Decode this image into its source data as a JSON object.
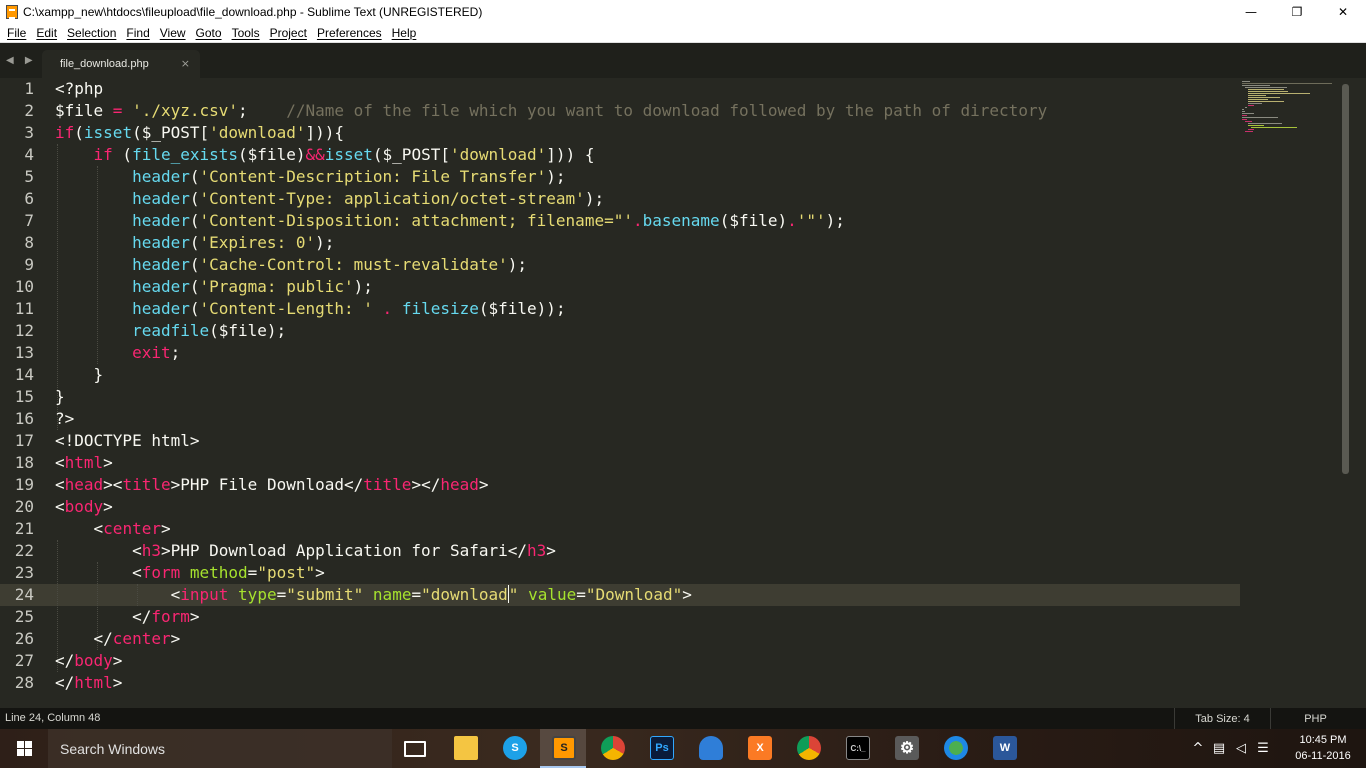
{
  "window": {
    "title": "C:\\xampp_new\\htdocs\\fileupload\\file_download.php - Sublime Text (UNREGISTERED)",
    "minimize": "—",
    "restore": "❐",
    "close": "✕"
  },
  "menu": [
    "File",
    "Edit",
    "Selection",
    "Find",
    "View",
    "Goto",
    "Tools",
    "Project",
    "Preferences",
    "Help"
  ],
  "tabs": [
    {
      "label": "file_download.php",
      "close": "×"
    }
  ],
  "tab_nav": "◀ ▶",
  "editor": {
    "current_line": 24,
    "line_numbers": [
      "1",
      "2",
      "3",
      "4",
      "5",
      "6",
      "7",
      "8",
      "9",
      "10",
      "11",
      "12",
      "13",
      "14",
      "15",
      "16",
      "17",
      "18",
      "19",
      "20",
      "21",
      "22",
      "23",
      "24",
      "25",
      "26",
      "27",
      "28"
    ]
  },
  "status": {
    "position": "Line 24, Column 48",
    "tab_size": "Tab Size: 4",
    "syntax": "PHP"
  },
  "taskbar": {
    "search_placeholder": "Search Windows",
    "apps": [
      {
        "name": "task-view",
        "glyph": "❐"
      },
      {
        "name": "file-explorer",
        "glyph": ""
      },
      {
        "name": "skype",
        "glyph": "S"
      },
      {
        "name": "sublime-text",
        "glyph": "S"
      },
      {
        "name": "chrome",
        "glyph": ""
      },
      {
        "name": "photoshop",
        "glyph": "Ps"
      },
      {
        "name": "shield",
        "glyph": ""
      },
      {
        "name": "xampp",
        "glyph": "X"
      },
      {
        "name": "chrome-2",
        "glyph": ""
      },
      {
        "name": "cmd",
        "glyph": "C:\\_"
      },
      {
        "name": "settings",
        "glyph": "⚙"
      },
      {
        "name": "web",
        "glyph": ""
      },
      {
        "name": "word",
        "glyph": "W"
      }
    ],
    "tray_glyphs": {
      "chevron": "^",
      "network": "▤",
      "volume": "◁",
      "message": "☰"
    },
    "time": "10:45 PM",
    "date": "06-11-2016"
  },
  "colors": {
    "editor_bg": "#272822",
    "keyword": "#f92672",
    "function": "#66d9ef",
    "string": "#e6db74",
    "comment": "#75715e",
    "attribute": "#a6e22e"
  }
}
